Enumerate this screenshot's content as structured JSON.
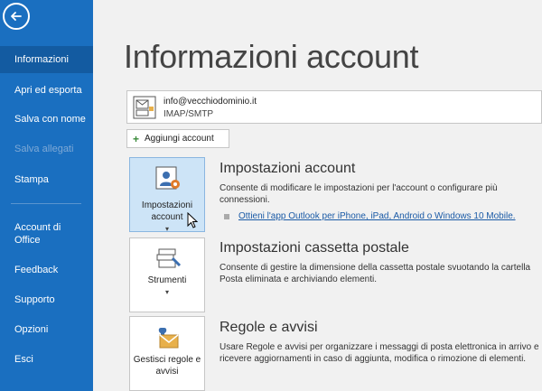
{
  "sidebar": {
    "back_icon": "arrow-left-icon",
    "items": [
      {
        "label": "Informazioni",
        "state": "active"
      },
      {
        "label": "Apri ed esporta",
        "state": "normal"
      },
      {
        "label": "Salva con nome",
        "state": "normal"
      },
      {
        "label": "Salva allegati",
        "state": "disabled"
      },
      {
        "label": "Stampa",
        "state": "normal"
      },
      {
        "label": "Account di Office",
        "state": "normal"
      },
      {
        "label": "Feedback",
        "state": "normal"
      },
      {
        "label": "Supporto",
        "state": "normal"
      },
      {
        "label": "Opzioni",
        "state": "normal"
      },
      {
        "label": "Esci",
        "state": "normal"
      }
    ]
  },
  "main": {
    "title": "Informazioni account",
    "account": {
      "email": "info@vecchiodominio.it",
      "type": "IMAP/SMTP"
    },
    "add_account_label": "Aggiungi account",
    "sections": [
      {
        "tile_label": "Impostazioni account",
        "title": "Impostazioni account",
        "desc": "Consente di modificare le impostazioni per l'account o configurare più connessioni.",
        "link": "Ottieni l'app Outlook per iPhone, iPad, Android o Windows 10 Mobile."
      },
      {
        "tile_label": "Strumenti",
        "title": "Impostazioni cassetta postale",
        "desc": "Consente di gestire la dimensione della cassetta postale svuotando la cartella Posta eliminata e archiviando elementi."
      },
      {
        "tile_label": "Gestisci regole e avvisi",
        "title": "Regole e avvisi",
        "desc": "Usare Regole e avvisi per organizzare i messaggi di posta elettronica in arrivo e ricevere aggiornamenti in caso di aggiunta, modifica o rimozione di elementi."
      }
    ]
  },
  "colors": {
    "sidebar": "#1a6fc0",
    "active": "#135ba1",
    "link": "#1a5aa6",
    "tile_selected": "#cde4f7"
  }
}
